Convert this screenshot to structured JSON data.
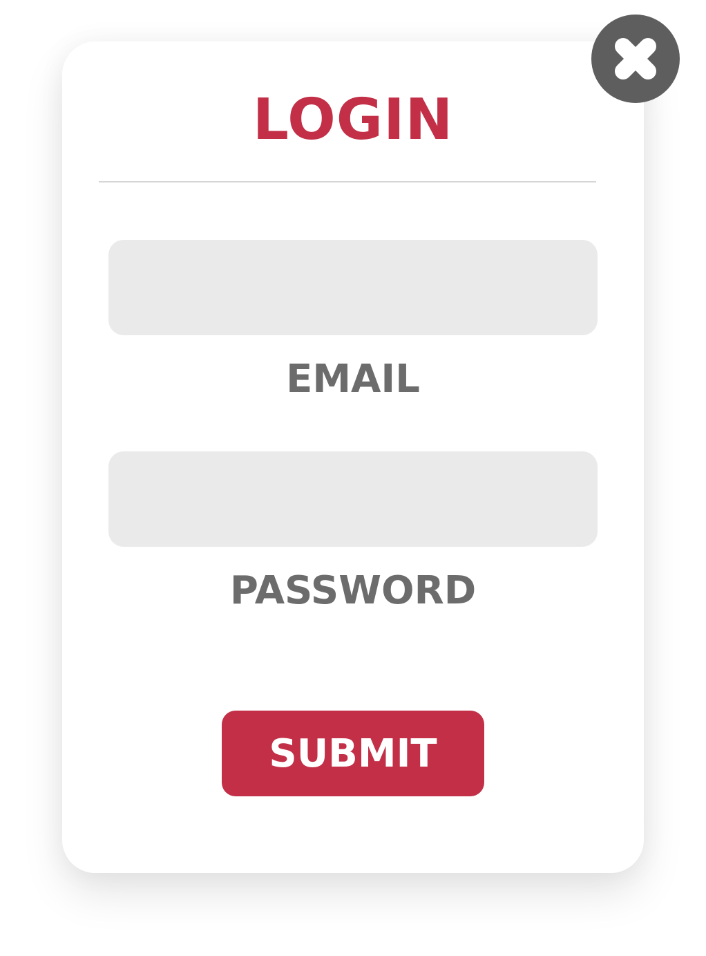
{
  "dialog": {
    "title": "LOGIN",
    "email_label": "EMAIL",
    "email_value": "",
    "password_label": "PASSWORD",
    "password_value": "",
    "submit_label": "SUBMIT",
    "close_icon": "close-icon"
  },
  "colors": {
    "accent": "#c22f46",
    "label": "#6c6c6c",
    "field_bg": "#eaeaea",
    "close_bg": "#5e5e5e"
  }
}
